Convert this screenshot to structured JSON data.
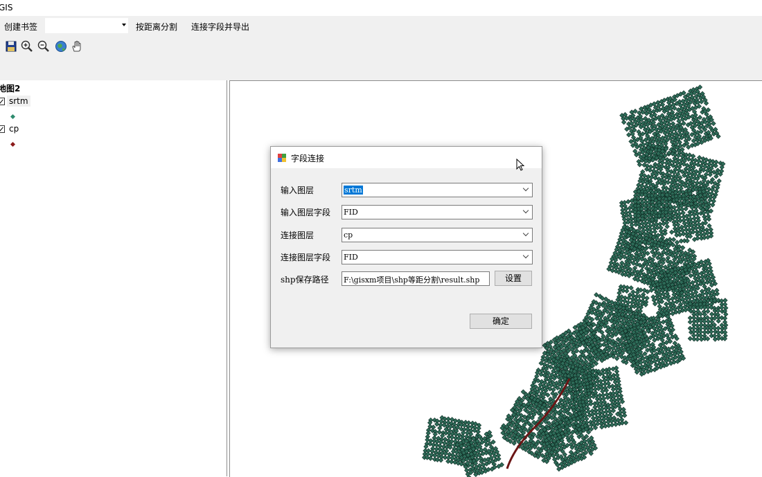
{
  "window": {
    "title": "GIS"
  },
  "menubar": {
    "create_bookmark": "创建书签",
    "bookmark_combo_value": "",
    "split_by_distance": "按距离分割",
    "join_and_export": "连接字段并导出"
  },
  "toolbar": {
    "buttons": [
      "save-icon",
      "zoom-in-icon",
      "zoom-out-icon",
      "full-extent-globe-icon",
      "pan-hand-icon"
    ]
  },
  "toc": {
    "map_name": "地图2",
    "layers": [
      {
        "name": "srtm",
        "checked": true,
        "symbol_color": "#2e8b6e"
      },
      {
        "name": "cp",
        "checked": true,
        "symbol_color": "#8b1a1a"
      }
    ]
  },
  "map": {
    "feature_color": "#2e6b58",
    "outline_color": "#0d2a22",
    "line_color": "#6b1515"
  },
  "dialog": {
    "title": "字段连接",
    "fields": [
      {
        "label": "输入图层",
        "value": "srtm",
        "selected": true
      },
      {
        "label": "输入图层字段",
        "value": "FID"
      },
      {
        "label": "连接图层",
        "value": "cp"
      },
      {
        "label": "连接图层字段",
        "value": "FID"
      }
    ],
    "path_label": "shp保存路径",
    "path_value": "F:\\gisxm项目\\shp等距分割\\result.shp",
    "settings_button": "设置",
    "ok_button": "确定"
  }
}
